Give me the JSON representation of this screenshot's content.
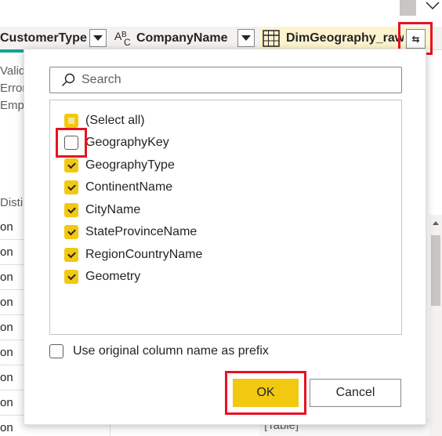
{
  "header": {
    "columns": [
      {
        "name": "CustomerType"
      },
      {
        "name": "CompanyName",
        "type_icon": "abc"
      },
      {
        "name": "DimGeography_raw",
        "type_icon": "table"
      }
    ],
    "expand_icon": "⇆"
  },
  "column_quality": [
    "Valid",
    "Error",
    "Empty"
  ],
  "distinct_label": "Distinct",
  "grid_values": [
    "on",
    "on",
    "on",
    "on",
    "on",
    "on",
    "on",
    "on",
    "on"
  ],
  "table_cell": "[Table]",
  "popup": {
    "search_placeholder": "Search",
    "items": [
      {
        "label": "(Select all)",
        "state": "partial"
      },
      {
        "label": "GeographyKey",
        "state": "unchecked"
      },
      {
        "label": "GeographyType",
        "state": "checked"
      },
      {
        "label": "ContinentName",
        "state": "checked"
      },
      {
        "label": "CityName",
        "state": "checked"
      },
      {
        "label": "StateProvinceName",
        "state": "checked"
      },
      {
        "label": "RegionCountryName",
        "state": "checked"
      },
      {
        "label": "Geometry",
        "state": "checked"
      }
    ],
    "prefix_label": "Use original column name as prefix",
    "prefix_checked": false,
    "ok_label": "OK",
    "cancel_label": "Cancel"
  },
  "colors": {
    "accent": "#f2c811",
    "highlight": "#e81123",
    "teal": "#14a497"
  }
}
